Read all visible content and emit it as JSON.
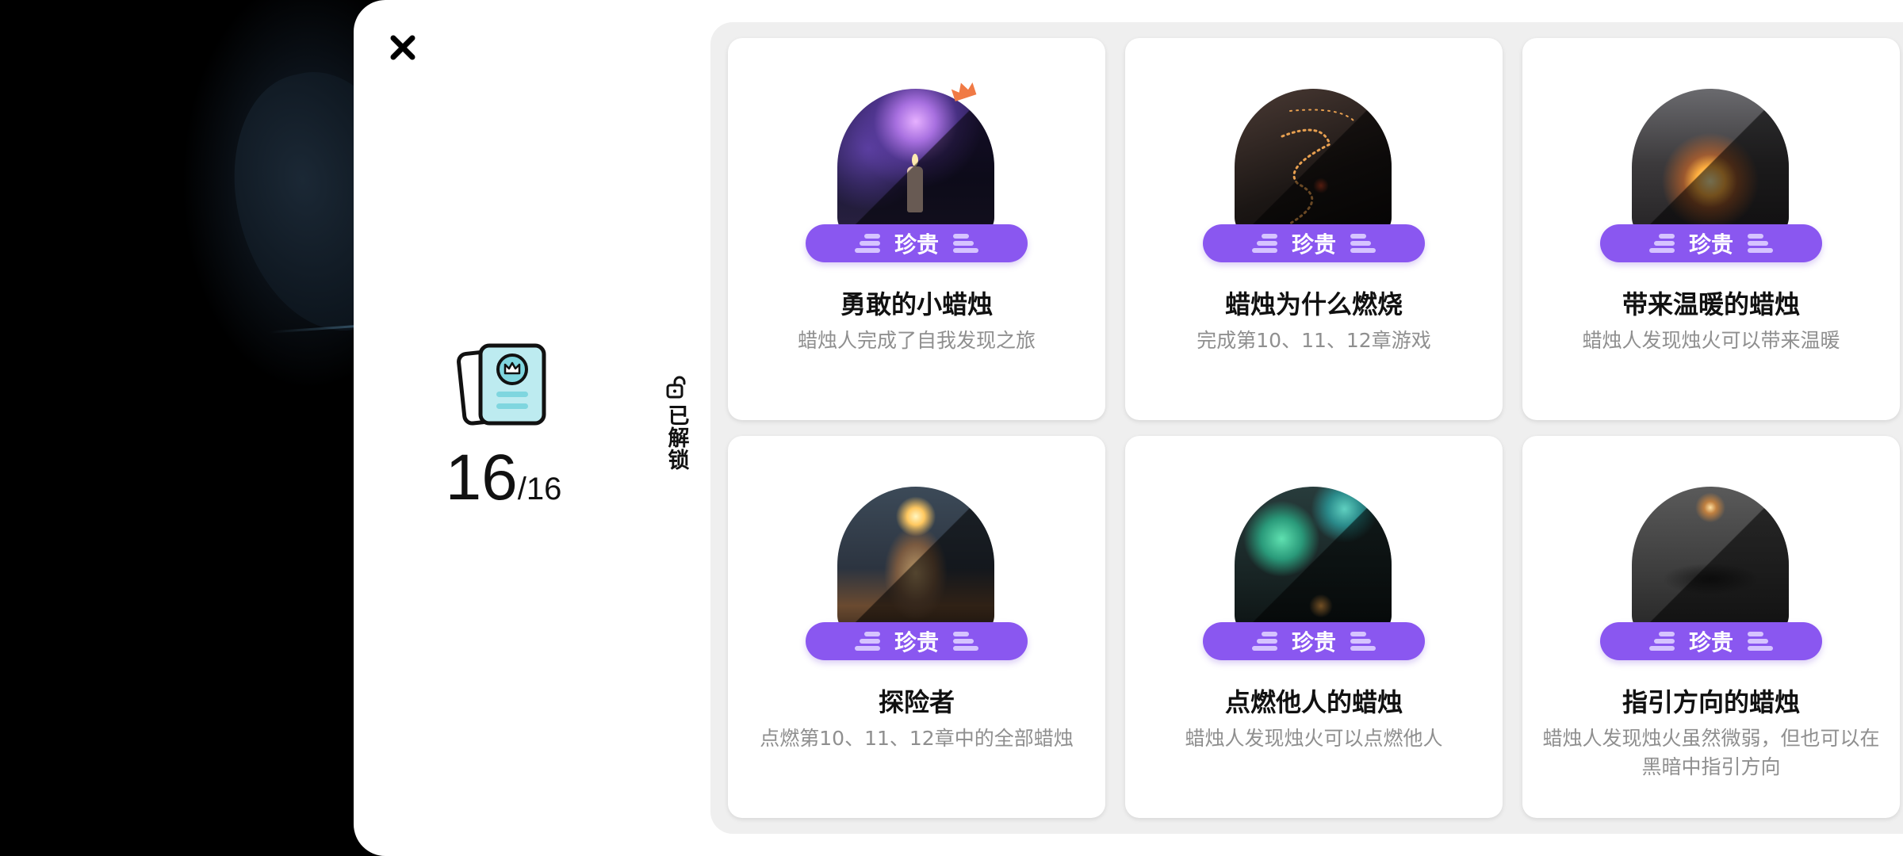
{
  "summary": {
    "unlocked_count": "16",
    "total": "/16"
  },
  "filter_tab": {
    "label": "已解锁"
  },
  "cards": [
    {
      "rarity": "珍贵",
      "title": "勇敢的小蜡烛",
      "desc": "蜡烛人完成了自我发现之旅",
      "icon": "fireworks-candle-art"
    },
    {
      "rarity": "珍贵",
      "title": "蜡烛为什么燃烧",
      "desc": "完成第10、11、12章游戏",
      "icon": "light-trail-art"
    },
    {
      "rarity": "珍贵",
      "title": "带来温暖的蜡烛",
      "desc": "蜡烛人发现烛火可以带来温暖",
      "icon": "glowing-lotus-art"
    },
    {
      "rarity": "珍贵",
      "title": "探险者",
      "desc": "点燃第10、11、12章中的全部蜡烛",
      "icon": "candle-explorer-art"
    },
    {
      "rarity": "珍贵",
      "title": "点燃他人的蜡烛",
      "desc": "蜡烛人发现烛火可以点燃他人",
      "icon": "green-fireworks-art"
    },
    {
      "rarity": "珍贵",
      "title": "指引方向的蜡烛",
      "desc": "蜡烛人发现烛火虽然微弱，但也可以在黑暗中指引方向",
      "icon": "guiding-light-art"
    }
  ],
  "colors": {
    "badge": "#8a57f0",
    "crown": "#f07a45",
    "icon_teal": "#7fd6df"
  }
}
